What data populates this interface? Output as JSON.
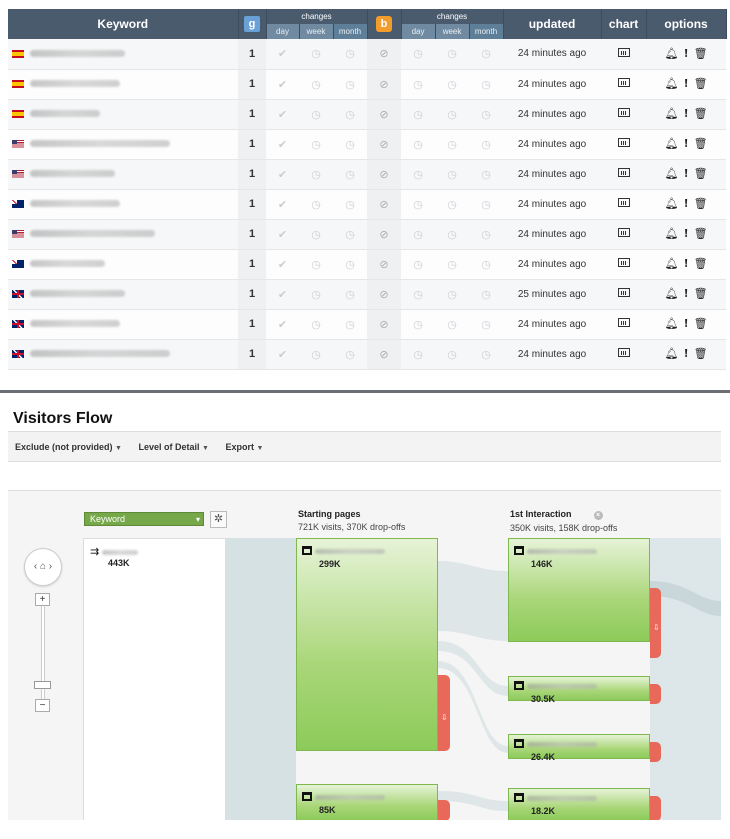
{
  "table": {
    "headers": {
      "keyword": "Keyword",
      "changes": "changes",
      "periods": [
        "day",
        "week",
        "month"
      ],
      "updated": "updated",
      "chart": "chart",
      "options": "options"
    },
    "engines": [
      {
        "name": "google",
        "glyph": "g",
        "color": "#6aa0d8"
      },
      {
        "name": "bing",
        "glyph": "b",
        "color": "#f39c2b"
      }
    ],
    "rows": [
      {
        "flag": "es",
        "keyword_blur_width": 95,
        "position": "1",
        "updated": "24 minutes ago"
      },
      {
        "flag": "es",
        "keyword_blur_width": 90,
        "position": "1",
        "updated": "24 minutes ago"
      },
      {
        "flag": "es",
        "keyword_blur_width": 70,
        "position": "1",
        "updated": "24 minutes ago"
      },
      {
        "flag": "us",
        "keyword_blur_width": 140,
        "position": "1",
        "updated": "24 minutes ago"
      },
      {
        "flag": "us",
        "keyword_blur_width": 85,
        "position": "1",
        "updated": "24 minutes ago"
      },
      {
        "flag": "au",
        "keyword_blur_width": 90,
        "position": "1",
        "updated": "24 minutes ago"
      },
      {
        "flag": "us",
        "keyword_blur_width": 125,
        "position": "1",
        "updated": "24 minutes ago"
      },
      {
        "flag": "au",
        "keyword_blur_width": 75,
        "position": "1",
        "updated": "24 minutes ago"
      },
      {
        "flag": "gb",
        "keyword_blur_width": 95,
        "position": "1",
        "updated": "25 minutes ago"
      },
      {
        "flag": "gb",
        "keyword_blur_width": 90,
        "position": "1",
        "updated": "24 minutes ago"
      },
      {
        "flag": "gb",
        "keyword_blur_width": 140,
        "position": "1",
        "updated": "24 minutes ago"
      }
    ],
    "icons": {
      "check": "check-icon",
      "clock": "clock-icon",
      "eye": "eye-slash-icon",
      "chart": "bar-chart-icon",
      "bell": "bell-icon",
      "alert": "alert-icon",
      "trash": "trash-icon"
    }
  },
  "visitors_flow": {
    "title": "Visitors Flow",
    "toolbar": [
      {
        "label": "Exclude (not provided)"
      },
      {
        "label": "Level of Detail"
      },
      {
        "label": "Export"
      }
    ],
    "dimension_select": "Keyword",
    "source": {
      "value": "443K"
    },
    "columns": [
      {
        "title": "Starting pages",
        "stats": "721K visits, 370K drop-offs"
      },
      {
        "title": "1st Interaction",
        "stats": "350K visits, 158K drop-offs"
      }
    ],
    "starting_nodes": [
      {
        "value": "299K"
      },
      {
        "value": "85K"
      }
    ],
    "interaction_nodes": [
      {
        "value": "146K"
      },
      {
        "value": "30.5K"
      },
      {
        "value": "26.4K"
      },
      {
        "value": "18.2K"
      }
    ],
    "colors": {
      "node": "#8ccb5a",
      "dropoff": "#e8685a",
      "flow_band": "#d3dfe3",
      "dimension": "#76a84a"
    }
  }
}
